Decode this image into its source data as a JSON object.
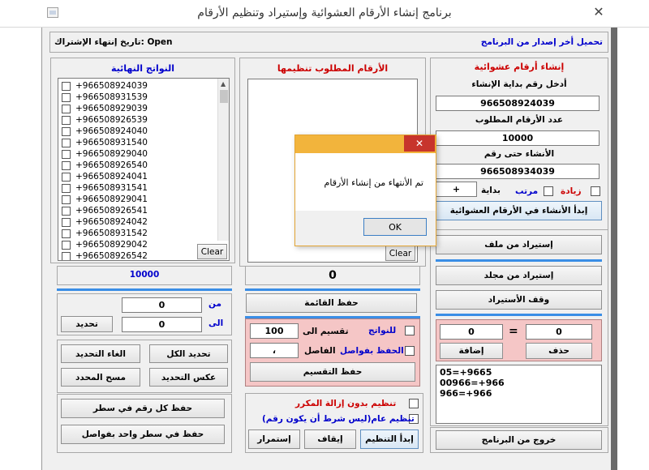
{
  "window": {
    "title": "برنامج إنشاء الأرقام العشوائية وإستيراد وتنظيم الأرقام",
    "close_glyph": "✕"
  },
  "header": {
    "download_link": "تحميل أخر إصدار من البرنامج",
    "expiry_label": "تاريخ إنتهاء الإشتراك: Open"
  },
  "generate": {
    "title": "إنشاء أرقام عشوائية",
    "start_label": "أدخل رقم بداية الإنشاء",
    "start_value": "966508924039",
    "count_label": "عدد الأرقام المطلوب",
    "count_value": "10000",
    "until_label": "الأنشاء حتى رقم",
    "until_value": "966508934039",
    "increase_label": "زيادة",
    "ordered_label": "مرتب",
    "prefix_label": "بداية",
    "prefix_value": "+",
    "start_button": "إبدأ الأنشاء في الأرقام العشوائية"
  },
  "import": {
    "from_file": "إستيراد من ملف",
    "from_folder": "إستيراد من مجلد",
    "stop": "وقف الأستيراد"
  },
  "replace": {
    "left_value": "0",
    "right_value": "0",
    "equals": "=",
    "add_button": "إضافة",
    "delete_button": "حذف",
    "rules": [
      "05=+9665",
      "00966=+966",
      "966=+966"
    ]
  },
  "exit_button": "خروج من البرنامج",
  "organize": {
    "title": "الأرقام المطلوب تنظيمها",
    "clear_button": "Clear",
    "count_value": "0",
    "save_list": "حفظ القائمة",
    "to_results_label": "للنواتج",
    "split_label": "تقسيم الى",
    "split_value": "100",
    "save_with_commas_label": "الحفظ بفواصل",
    "separator_label": "الفاصل",
    "separator_value": "،",
    "save_split": "حفظ التقسيم",
    "no_dup_label": "تنظيم بدون إزالة المكرر",
    "general_label": "تنظيم عام(ليس شرط أن يكون رقم)",
    "start_org": "إبدأ التنظيم",
    "stop_btn": "إيقاف",
    "continue_btn": "إستمرار"
  },
  "dialog": {
    "message": "تم الأنتهاء من إنشاء الأرقام",
    "ok": "OK",
    "close_glyph": "✕"
  },
  "results": {
    "title": "النواتج النهائية",
    "items": [
      "+966508924039",
      "+966508931539",
      "+966508929039",
      "+966508926539",
      "+966508924040",
      "+966508931540",
      "+966508929040",
      "+966508926540",
      "+966508924041",
      "+966508931541",
      "+966508929041",
      "+966508926541",
      "+966508924042",
      "+966508931542",
      "+966508929042",
      "+966508926542"
    ],
    "clear_button": "Clear",
    "count_value": "10000",
    "from_label": "من",
    "from_value": "0",
    "to_label": "الى",
    "to_value": "0",
    "select_button": "تحديد",
    "select_all": "تحديد الكل",
    "deselect": "الغاء التحديد",
    "invert": "عكس التحديد",
    "delete_selected": "مسح المحدد",
    "save_each_line": "حفظ كل رقم في سطر",
    "save_one_line": "حفظ في سطر واحد بفواصل"
  }
}
